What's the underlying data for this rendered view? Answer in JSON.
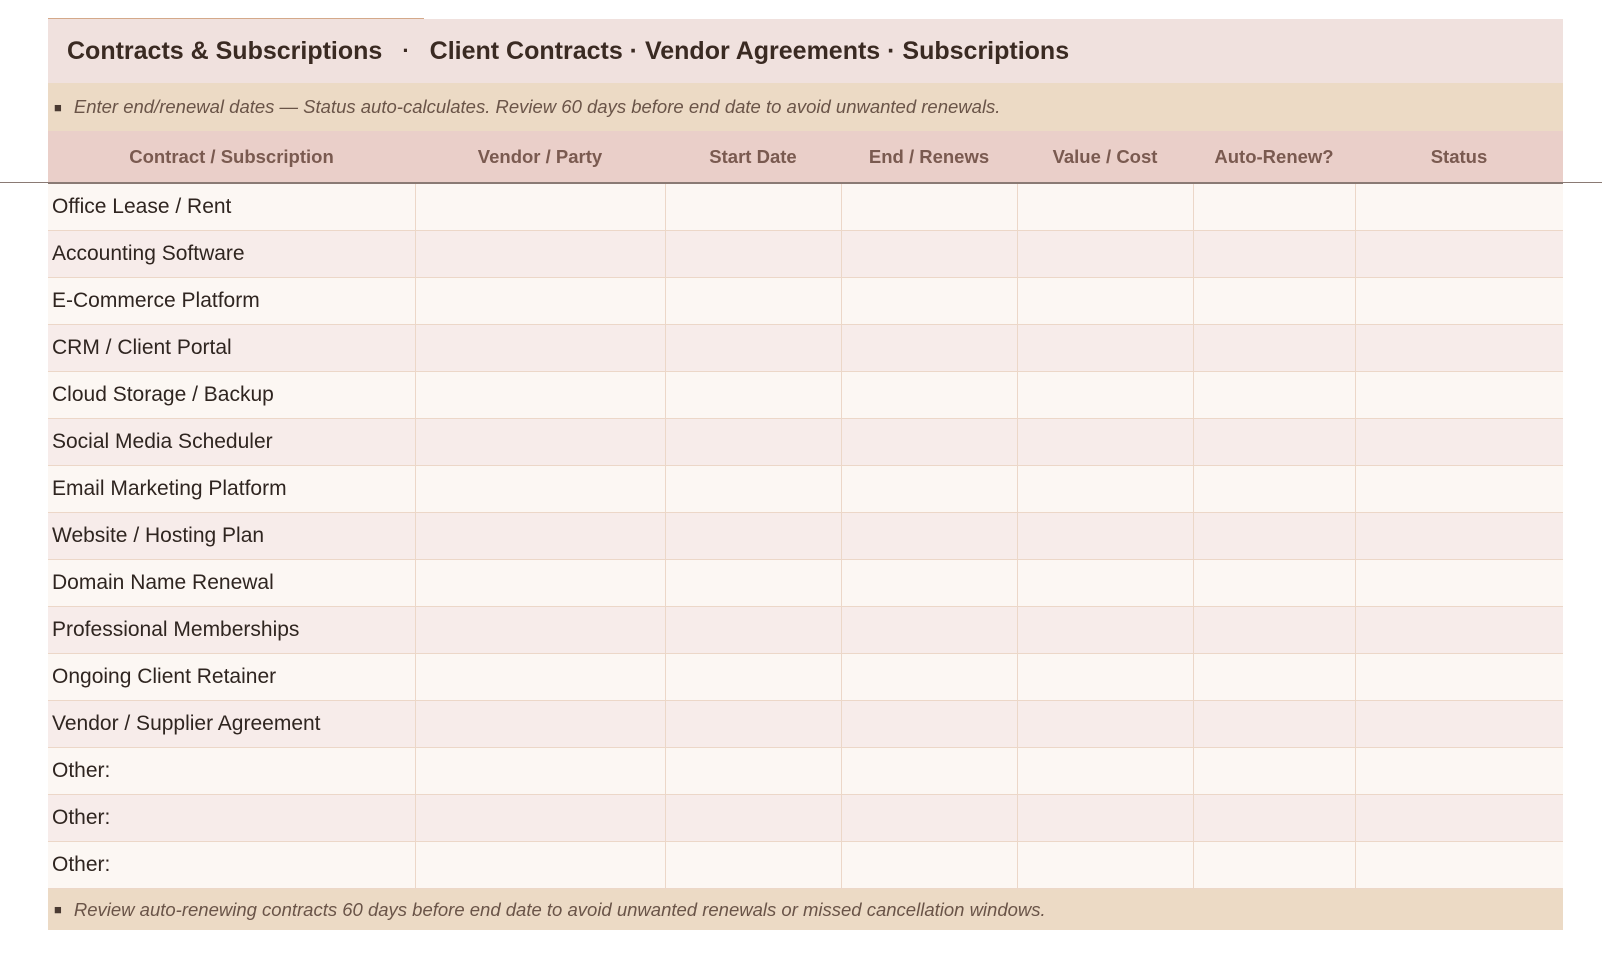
{
  "title": {
    "main": "Contracts & Subscriptions",
    "separator": "·",
    "subtitle": "Client Contracts · Vendor Agreements · Subscriptions"
  },
  "instruction_note": {
    "bullet": "■",
    "text": "Enter end/renewal dates — Status auto-calculates. Review 60 days before end date to avoid unwanted renewals."
  },
  "table": {
    "columns": [
      "Contract / Subscription",
      "Vendor / Party",
      "Start Date",
      "End / Renews",
      "Value / Cost",
      "Auto-Renew?",
      "Status"
    ],
    "rows": [
      "Office Lease / Rent",
      "Accounting Software",
      "E-Commerce Platform",
      "CRM / Client Portal",
      "Cloud Storage / Backup",
      "Social Media Scheduler",
      "Email Marketing Platform",
      "Website / Hosting Plan",
      "Domain Name Renewal",
      "Professional Memberships",
      "Ongoing Client Retainer",
      "Vendor / Supplier Agreement",
      "Other:",
      "Other:",
      "Other:"
    ]
  },
  "footer_note": {
    "bullet": "■",
    "text": "Review auto-renewing contracts 60 days before end date to avoid unwanted renewals or missed cancellation windows."
  },
  "colors": {
    "title_bg": "#f0e1de",
    "note_bg": "#ecdac5",
    "header_bg": "#eacfc9",
    "row_odd": "#fcf7f3",
    "row_even": "#f7ecea",
    "accent": "#d4a98a"
  }
}
